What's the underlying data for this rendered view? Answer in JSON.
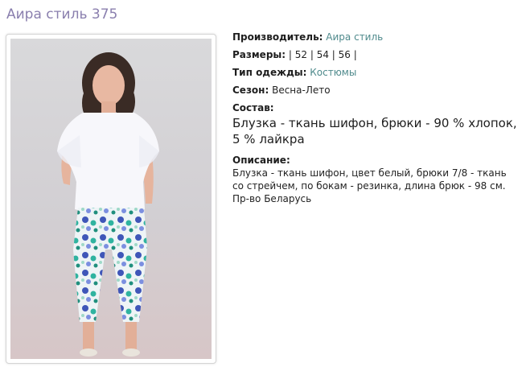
{
  "title": "Аира стиль 375",
  "product": {
    "manufacturer_label": "Производитель:",
    "manufacturer_value": "Аира стиль",
    "sizes_label": "Размеры:",
    "sizes_value": "| 52 | 54 | 56 |",
    "type_label": "Тип одежды:",
    "type_value": "Костюмы",
    "season_label": "Сезон:",
    "season_value": "Весна-Лето",
    "composition_label": "Состав:",
    "composition_value": "Блузка - ткань шифон, брюки - 90 % хлопок, 5 % лайкра",
    "description_label": "Описание:",
    "description_value": "Блузка - ткань шифон, цвет белый, брюки 7/8 - ткань со стрейчем, по бокам - резинка, длина брюк - 98 см. Пр-во Беларусь"
  },
  "colors": {
    "title": "#8a7fae",
    "link": "#4f8a8c"
  }
}
